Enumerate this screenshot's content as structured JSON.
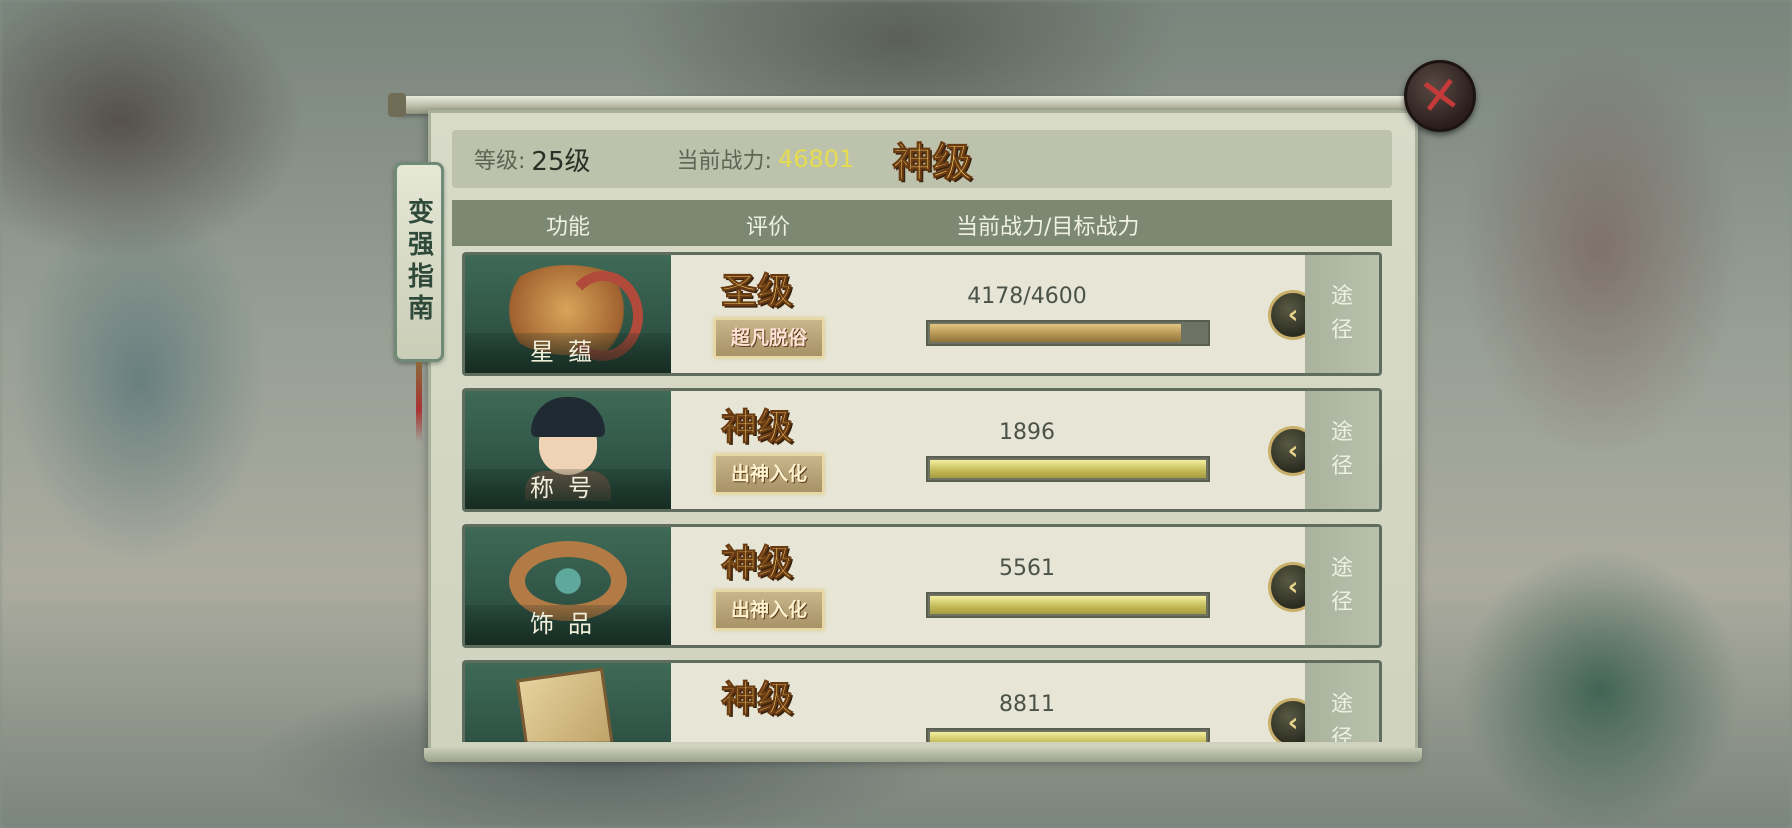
{
  "panel": {
    "side_tab_label": "变强指南",
    "close_icon": "close-x-icon"
  },
  "info": {
    "level_label": "等级:",
    "level_value": "25级",
    "power_label": "当前战力:",
    "power_value": "46801",
    "overall_grade": "神级"
  },
  "table": {
    "headers": [
      "功能",
      "评价",
      "当前战力/目标战力"
    ]
  },
  "rows": [
    {
      "name": "星蕴",
      "grade": "圣级",
      "grade_sub": "超凡脱俗",
      "power": "4178/4600",
      "progress": 0.908,
      "route": "途径",
      "icon": "dragon-icon"
    },
    {
      "name": "称号",
      "grade": "神级",
      "grade_sub": "出神入化",
      "power": "1896",
      "progress": 1.0,
      "route": "途径",
      "icon": "hero-portrait-icon"
    },
    {
      "name": "饰品",
      "grade": "神级",
      "grade_sub": "出神入化",
      "power": "5561",
      "progress": 1.0,
      "route": "途径",
      "icon": "bracelet-icon"
    },
    {
      "name": "",
      "grade": "神级",
      "grade_sub": "",
      "power": "8811",
      "progress": 1.0,
      "route": "途径",
      "icon": "scroll-map-icon"
    }
  ],
  "colors": {
    "power_highlight": "#e7dc4f",
    "grade_gold": "#f2cf6a",
    "close_red": "#c43a3a"
  }
}
